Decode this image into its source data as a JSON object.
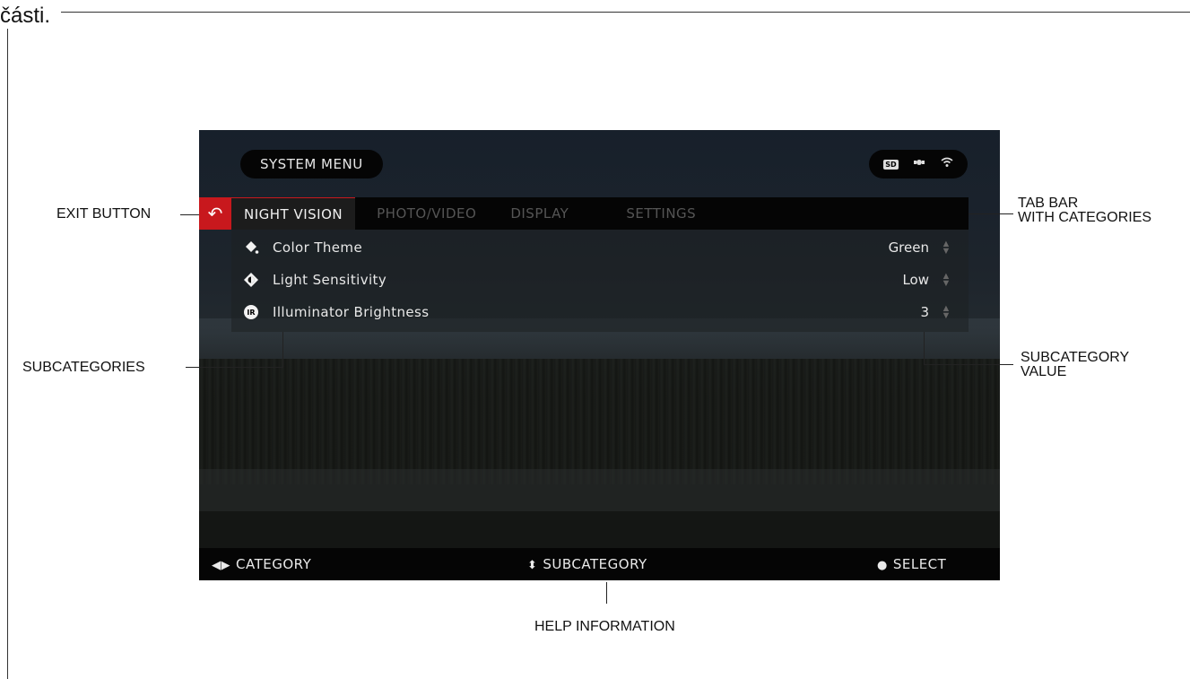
{
  "top_caption": "části.",
  "device": {
    "title": "SYSTEM MENU",
    "status_icons": [
      {
        "name": "sd-card-icon",
        "label": "SD"
      },
      {
        "name": "gps-satellite-icon",
        "label": "✴"
      },
      {
        "name": "wifi-icon",
        "label": "▿"
      }
    ],
    "exit_icon": "↶",
    "tabs": [
      "NIGHT VISION",
      "PHOTO/VIDEO",
      "DISPLAY",
      "SETTINGS"
    ],
    "active_tab": "NIGHT VISION",
    "menu_items": [
      {
        "icon": "paint-bucket-icon",
        "label": "Color Theme",
        "value": "Green"
      },
      {
        "icon": "light-sensitivity-icon",
        "label": "Light Sensitivity",
        "value": "Low"
      },
      {
        "icon": "ir-illuminator-icon",
        "icon_text": "IR",
        "label": "Illuminator Brightness",
        "value": "3"
      }
    ],
    "help_bar": {
      "category": "CATEGORY",
      "subcategory": "SUBCATEGORY",
      "select": "SELECT"
    },
    "colors": {
      "accent": "#c8181d",
      "panel": "#050505"
    }
  },
  "callouts": {
    "exit_button": "EXIT BUTTON",
    "tab_bar_1": "TAB BAR",
    "tab_bar_2": "WITH CATEGORIES",
    "subcategories": "SUBCATEGORIES",
    "subcategory_value_1": "SUBCATEGORY",
    "subcategory_value_2": "VALUE",
    "help_information": "HELP INFORMATION"
  }
}
